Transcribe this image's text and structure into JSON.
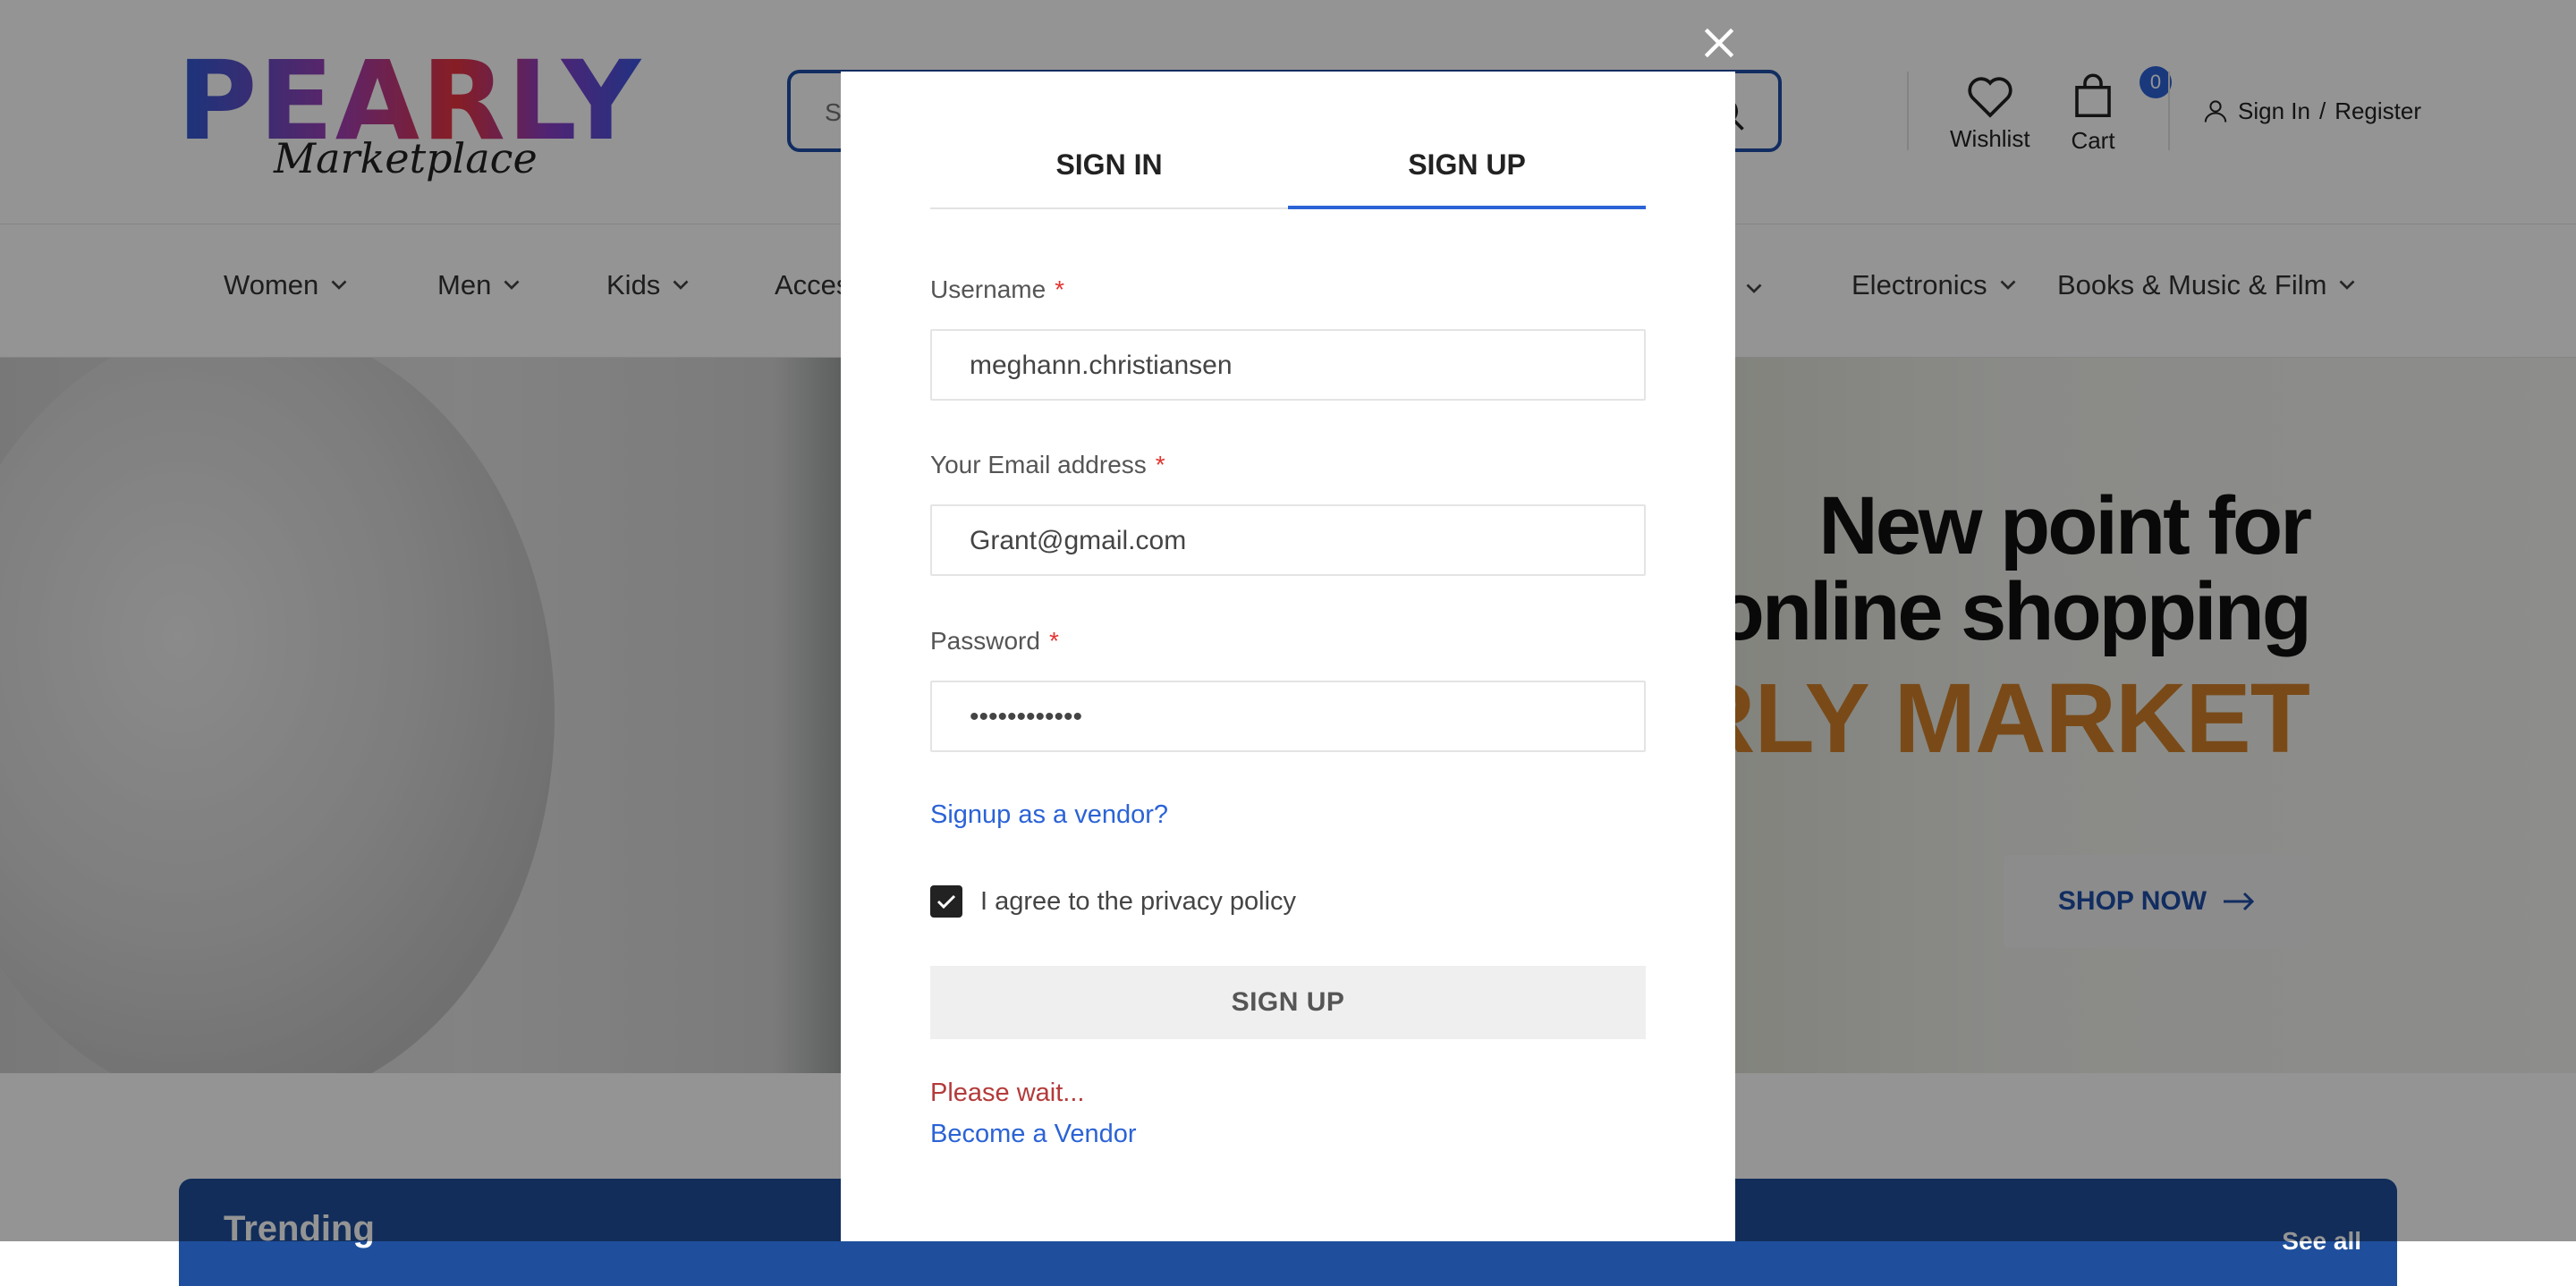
{
  "header": {
    "logo_main": "PEARLY",
    "logo_sub": "Marketplace",
    "search_placeholder": "S",
    "wishlist_label": "Wishlist",
    "cart_label": "Cart",
    "cart_count": "0",
    "sign_in_label": "Sign In",
    "separator": "/",
    "register_label": "Register"
  },
  "nav": {
    "items": [
      {
        "label": "Women"
      },
      {
        "label": "Men"
      },
      {
        "label": "Kids"
      },
      {
        "label": "Acces"
      },
      {
        "label": "Electronics"
      },
      {
        "label": "Books & Music & Film"
      }
    ]
  },
  "hero": {
    "title_line1": "New point for",
    "title_line2": "online shopping",
    "brand": "ARLY MARKET",
    "shop_now": "SHOP NOW"
  },
  "trending": {
    "title": "Trending",
    "see_all": "See all"
  },
  "modal": {
    "tab_signin": "SIGN IN",
    "tab_signup": "SIGN UP",
    "username_label": "Username",
    "username_value": "meghann.christiansen",
    "email_label": "Your Email address",
    "email_value": "Grant@gmail.com",
    "password_label": "Password",
    "password_value": "••••••••••••",
    "required_mark": "*",
    "vendor_signup_link": "Signup as a vendor?",
    "agree_label": "I agree to the privacy policy",
    "agree_checked": true,
    "submit_label": "SIGN UP",
    "status_text": "Please wait...",
    "become_vendor_link": "Become a Vendor"
  },
  "colors": {
    "accent": "#2b63d6",
    "brand_dark_blue": "#1e4ea8",
    "hero_orange": "#d0802a",
    "status_red": "#b43a3a",
    "required_red": "#e3342f"
  }
}
